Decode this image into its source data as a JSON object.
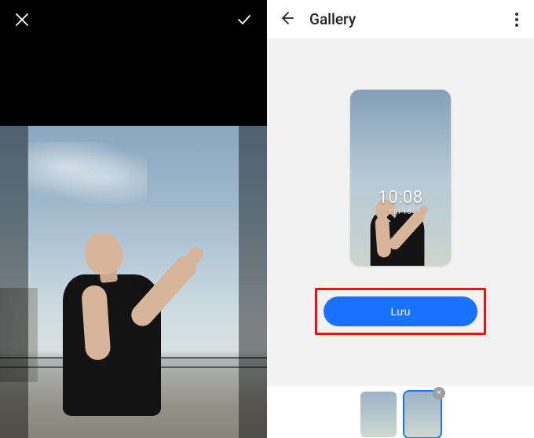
{
  "left": {
    "close_label": "Close",
    "confirm_label": "Confirm"
  },
  "right": {
    "back_label": "Back",
    "title": "Gallery",
    "more_label": "More options",
    "lock": {
      "time": "10:08",
      "date": "FRI 18"
    },
    "save_label": "Lưu",
    "thumb_remove_label": "×"
  }
}
